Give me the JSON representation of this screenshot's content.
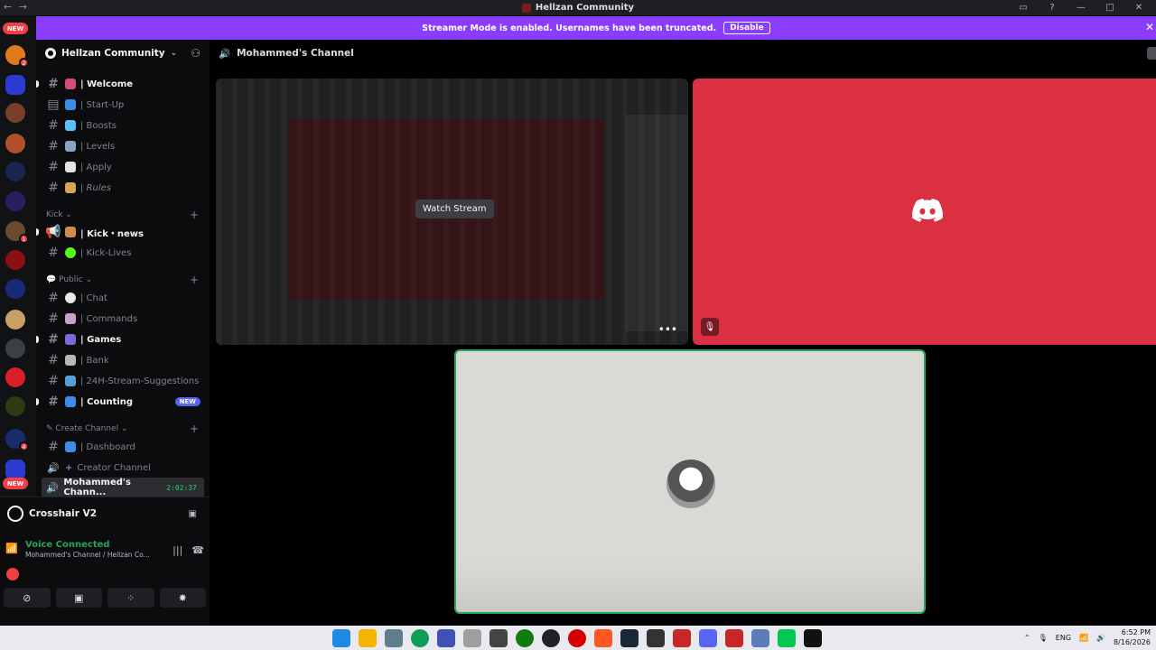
{
  "window": {
    "title": "Hellzan Community"
  },
  "banner": {
    "text": "Streamer Mode is enabled. Usernames have been truncated.",
    "button": "Disable"
  },
  "rail": {
    "new_top": "NEW",
    "new_bottom": "NEW",
    "badges": [
      "2",
      "1",
      "4"
    ]
  },
  "server": {
    "name": "Hellzan Community"
  },
  "channels": [
    {
      "label": "| Welcome",
      "bold": true
    },
    {
      "label": "| Start-Up"
    },
    {
      "label": "| Boosts"
    },
    {
      "label": "| Levels"
    },
    {
      "label": "| Apply"
    },
    {
      "label": "| Rules"
    },
    {
      "label": "| Kick・news",
      "bold": true
    },
    {
      "label": "| Kick-Lives"
    },
    {
      "label": "| Chat"
    },
    {
      "label": "| Commands"
    },
    {
      "label": "| Games",
      "bold": true
    },
    {
      "label": "| Bank"
    },
    {
      "label": "| 24H-Stream-Suggestions"
    },
    {
      "label": "| Counting",
      "bold": true,
      "tag": "NEW"
    },
    {
      "label": "| Dashboard"
    },
    {
      "label": "Creator Channel"
    },
    {
      "label": "Mohammed's Chann...",
      "timer": "2:02:37"
    }
  ],
  "categories": {
    "kick": "Kick",
    "public": "Public",
    "create": "Create Channel"
  },
  "panel": {
    "activity": "Crosshair V2",
    "voice_state": "Voice Connected",
    "voice_sub": "Mohammed's Channel / Hellzan Co..."
  },
  "main": {
    "channel_name": "Mohammed's Channel",
    "watch_label": "Watch Stream",
    "more_label": "•••"
  },
  "taskbar": {
    "lang": "ENG",
    "time": "6:52 PM",
    "date": "8/16/2026"
  },
  "colors": {
    "accent": "#8b3dff",
    "discord_red": "#da3042",
    "voice_green": "#23a55a"
  }
}
